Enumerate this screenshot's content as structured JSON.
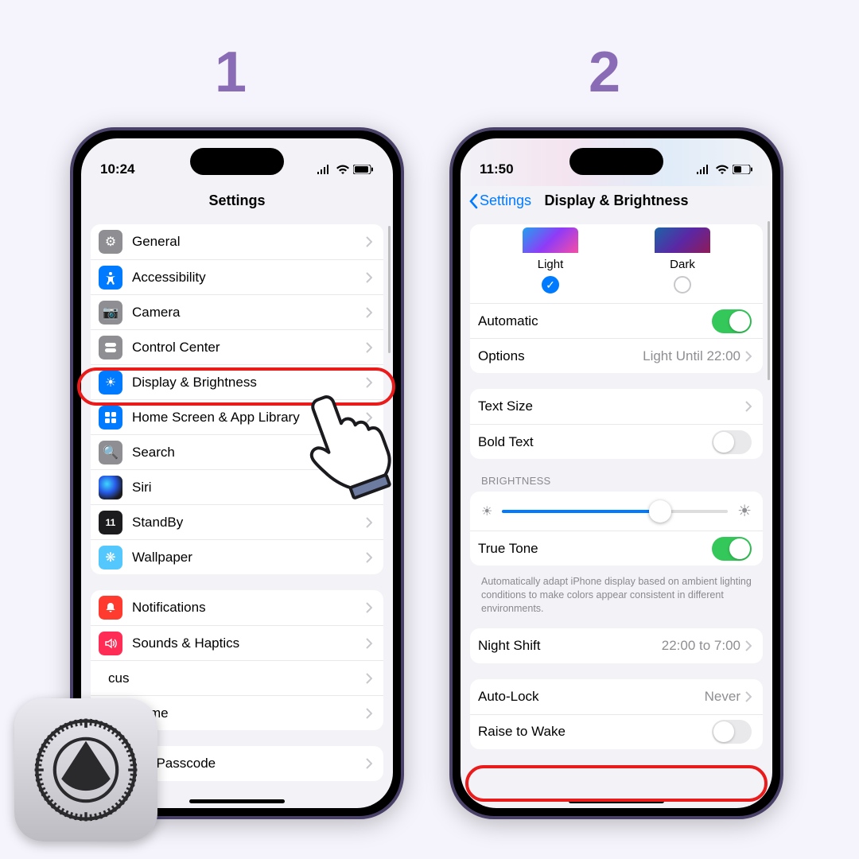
{
  "steps": {
    "one": "1",
    "two": "2"
  },
  "phone1": {
    "time": "10:24",
    "title": "Settings",
    "group1": [
      {
        "label": "General",
        "icon": "gear-icon",
        "bg": "bg-grey"
      },
      {
        "label": "Accessibility",
        "icon": "accessibility-icon",
        "bg": "bg-blue"
      },
      {
        "label": "Camera",
        "icon": "camera-icon",
        "bg": "bg-grey"
      },
      {
        "label": "Control Center",
        "icon": "switches-icon",
        "bg": "bg-grey"
      },
      {
        "label": "Display & Brightness",
        "icon": "brightness-icon",
        "bg": "bg-blue"
      },
      {
        "label": "Home Screen & App Library",
        "icon": "grid-icon",
        "bg": "bg-blue"
      },
      {
        "label": "Search",
        "icon": "search-icon",
        "bg": "bg-grey"
      },
      {
        "label": "Siri",
        "icon": "siri-icon",
        "bg": "bg-siri"
      },
      {
        "label": "StandBy",
        "icon": "clock-icon",
        "bg": "bg-black"
      },
      {
        "label": "Wallpaper",
        "icon": "flower-icon",
        "bg": "bg-cyan"
      }
    ],
    "group2": [
      {
        "label": "Notifications",
        "icon": "bell-icon",
        "bg": "bg-red"
      },
      {
        "label": "Sounds & Haptics",
        "icon": "speaker-icon",
        "bg": "bg-pink"
      },
      {
        "label": "Focus",
        "icon": "moon-icon",
        "bg": "bg-indigo",
        "trunc": "cus"
      },
      {
        "label": "Screen Time",
        "icon": "hourglass-icon",
        "bg": "bg-indigo",
        "trunc": "reen Time"
      }
    ],
    "group3": [
      {
        "label": "Face ID & Passcode",
        "icon": "faceid-icon",
        "bg": "bg-green",
        "trunc": "ce ID & Passcode"
      }
    ]
  },
  "phone2": {
    "time": "11:50",
    "back": "Settings",
    "title": "Display & Brightness",
    "appearance": {
      "light": "Light",
      "dark": "Dark",
      "automatic": "Automatic",
      "options": "Options",
      "options_val": "Light Until 22:00"
    },
    "text": {
      "text_size": "Text Size",
      "bold_text": "Bold Text"
    },
    "brightness_header": "BRIGHTNESS",
    "brightness": {
      "true_tone": "True Tone",
      "footer": "Automatically adapt iPhone display based on ambient lighting conditions to make colors appear consistent in different environments."
    },
    "night_shift": {
      "label": "Night Shift",
      "val": "22:00 to 7:00"
    },
    "auto_lock": {
      "label": "Auto-Lock",
      "val": "Never"
    },
    "raise": "Raise to Wake"
  }
}
